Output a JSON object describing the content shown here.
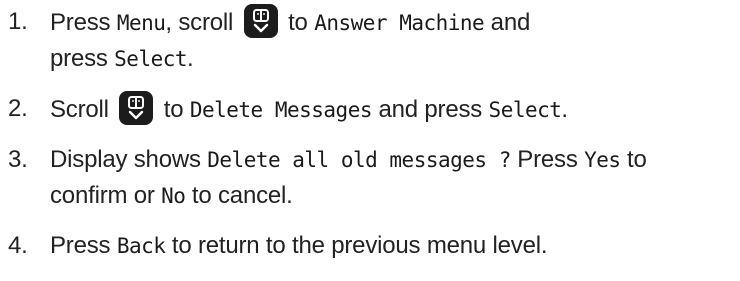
{
  "steps": [
    {
      "number": "1.",
      "parts": {
        "t1": "Press ",
        "k1": "Menu",
        "t2": ", scroll",
        "t3": " to ",
        "k2": "Answer Machine",
        "t4": " and",
        "t5": "press ",
        "k3": "Select",
        "t6": "."
      }
    },
    {
      "number": "2.",
      "parts": {
        "t1": "Scroll",
        "t2": " to ",
        "k1": "Delete Messages",
        "t3": " and press ",
        "k2": "Select",
        "t4": "."
      }
    },
    {
      "number": "3.",
      "parts": {
        "t1": "Display shows ",
        "k1": "Delete all old messages ?",
        "t2": " Press ",
        "k2": "Yes",
        "t3": " to",
        "t4": "confirm or ",
        "k3": "No",
        "t5": " to cancel."
      }
    },
    {
      "number": "4.",
      "parts": {
        "t1": "Press ",
        "k1": "Back",
        "t2": " to return to the previous menu level."
      }
    }
  ],
  "icons": {
    "scroll_key": "phonebook-scroll-key-icon"
  },
  "colors": {
    "text": "#222222",
    "key_background": "#1c1c1c",
    "key_symbol": "#ffffff"
  }
}
